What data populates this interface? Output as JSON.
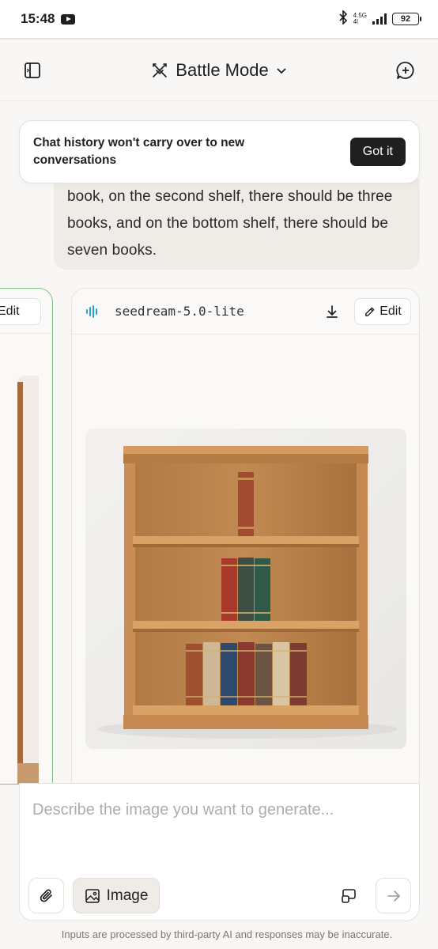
{
  "status_bar": {
    "time": "15:48",
    "network_top": "4.5G",
    "network_bottom": "4l",
    "battery": "92"
  },
  "header": {
    "mode_label": "Battle Mode"
  },
  "toast": {
    "text": "Chat history won't carry over to new conversations",
    "button_label": "Got it"
  },
  "user_message": {
    "text": "book, on the second shelf, there should be three books, and on the bottom shelf, there should be seven books."
  },
  "left_card": {
    "edit_label": "Edit"
  },
  "model_card": {
    "model_name": "seedream-5.0-lite",
    "edit_label": "Edit"
  },
  "composer": {
    "placeholder": "Describe the image you want to generate...",
    "image_label": "Image"
  },
  "disclaimer": "Inputs are processed by third-party AI and responses may be inaccurate.",
  "colors": {
    "accent_green": "#7bc47f",
    "dark_button": "#1f1f1f",
    "audio_blue": "#2a9fd6"
  },
  "icons": [
    "sidebar-toggle-icon",
    "battle-swords-icon",
    "chevron-down-icon",
    "new-chat-icon",
    "audio-wave-icon",
    "download-icon",
    "pencil-icon",
    "paperclip-icon",
    "image-icon",
    "layout-icon",
    "arrow-right-icon"
  ]
}
